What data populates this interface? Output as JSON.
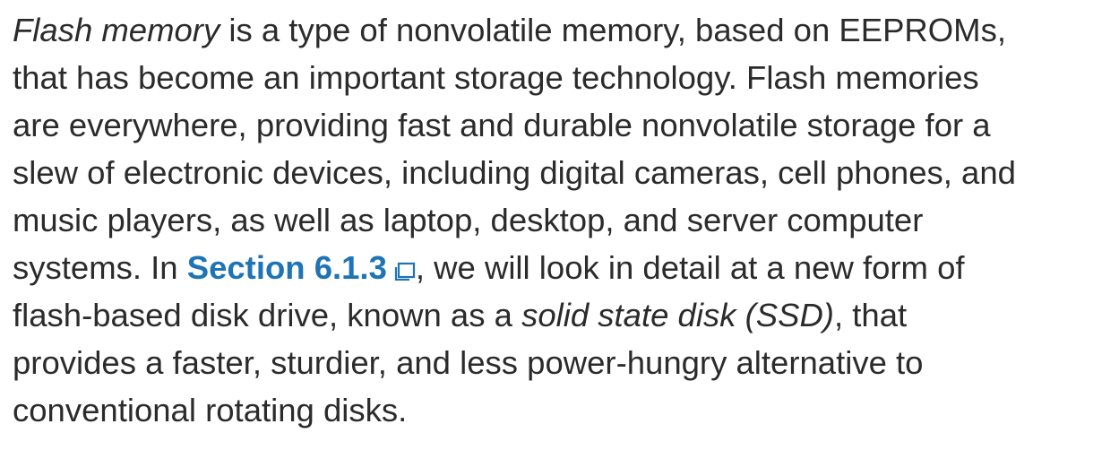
{
  "paragraph": {
    "lines": [
      {
        "term": "Flash memory",
        "text": " is a type of nonvolatile memory, based on EEPROMs,"
      },
      {
        "text": "that has become an important storage technology. Flash memories"
      },
      {
        "text": "are everywhere, providing fast and durable nonvolatile storage for a"
      },
      {
        "text": "slew of electronic devices, including digital cameras, cell phones, and"
      },
      {
        "text": "music players, as well as laptop, desktop, and server computer"
      },
      {
        "before": "systems. In ",
        "link": "Section 6.1.3",
        "after": ", we will look in detail at a new form of"
      },
      {
        "before": "flash-based disk drive, known as a ",
        "term": "solid state disk (SSD)",
        "after": ", that"
      },
      {
        "text": "provides a faster, sturdier, and less power-hungry alternative to"
      },
      {
        "text": "conventional rotating disks."
      }
    ]
  },
  "colors": {
    "text": "#2b2b2b",
    "link": "#1f74b5"
  },
  "icons": {
    "link_icon": "external-window-icon"
  }
}
